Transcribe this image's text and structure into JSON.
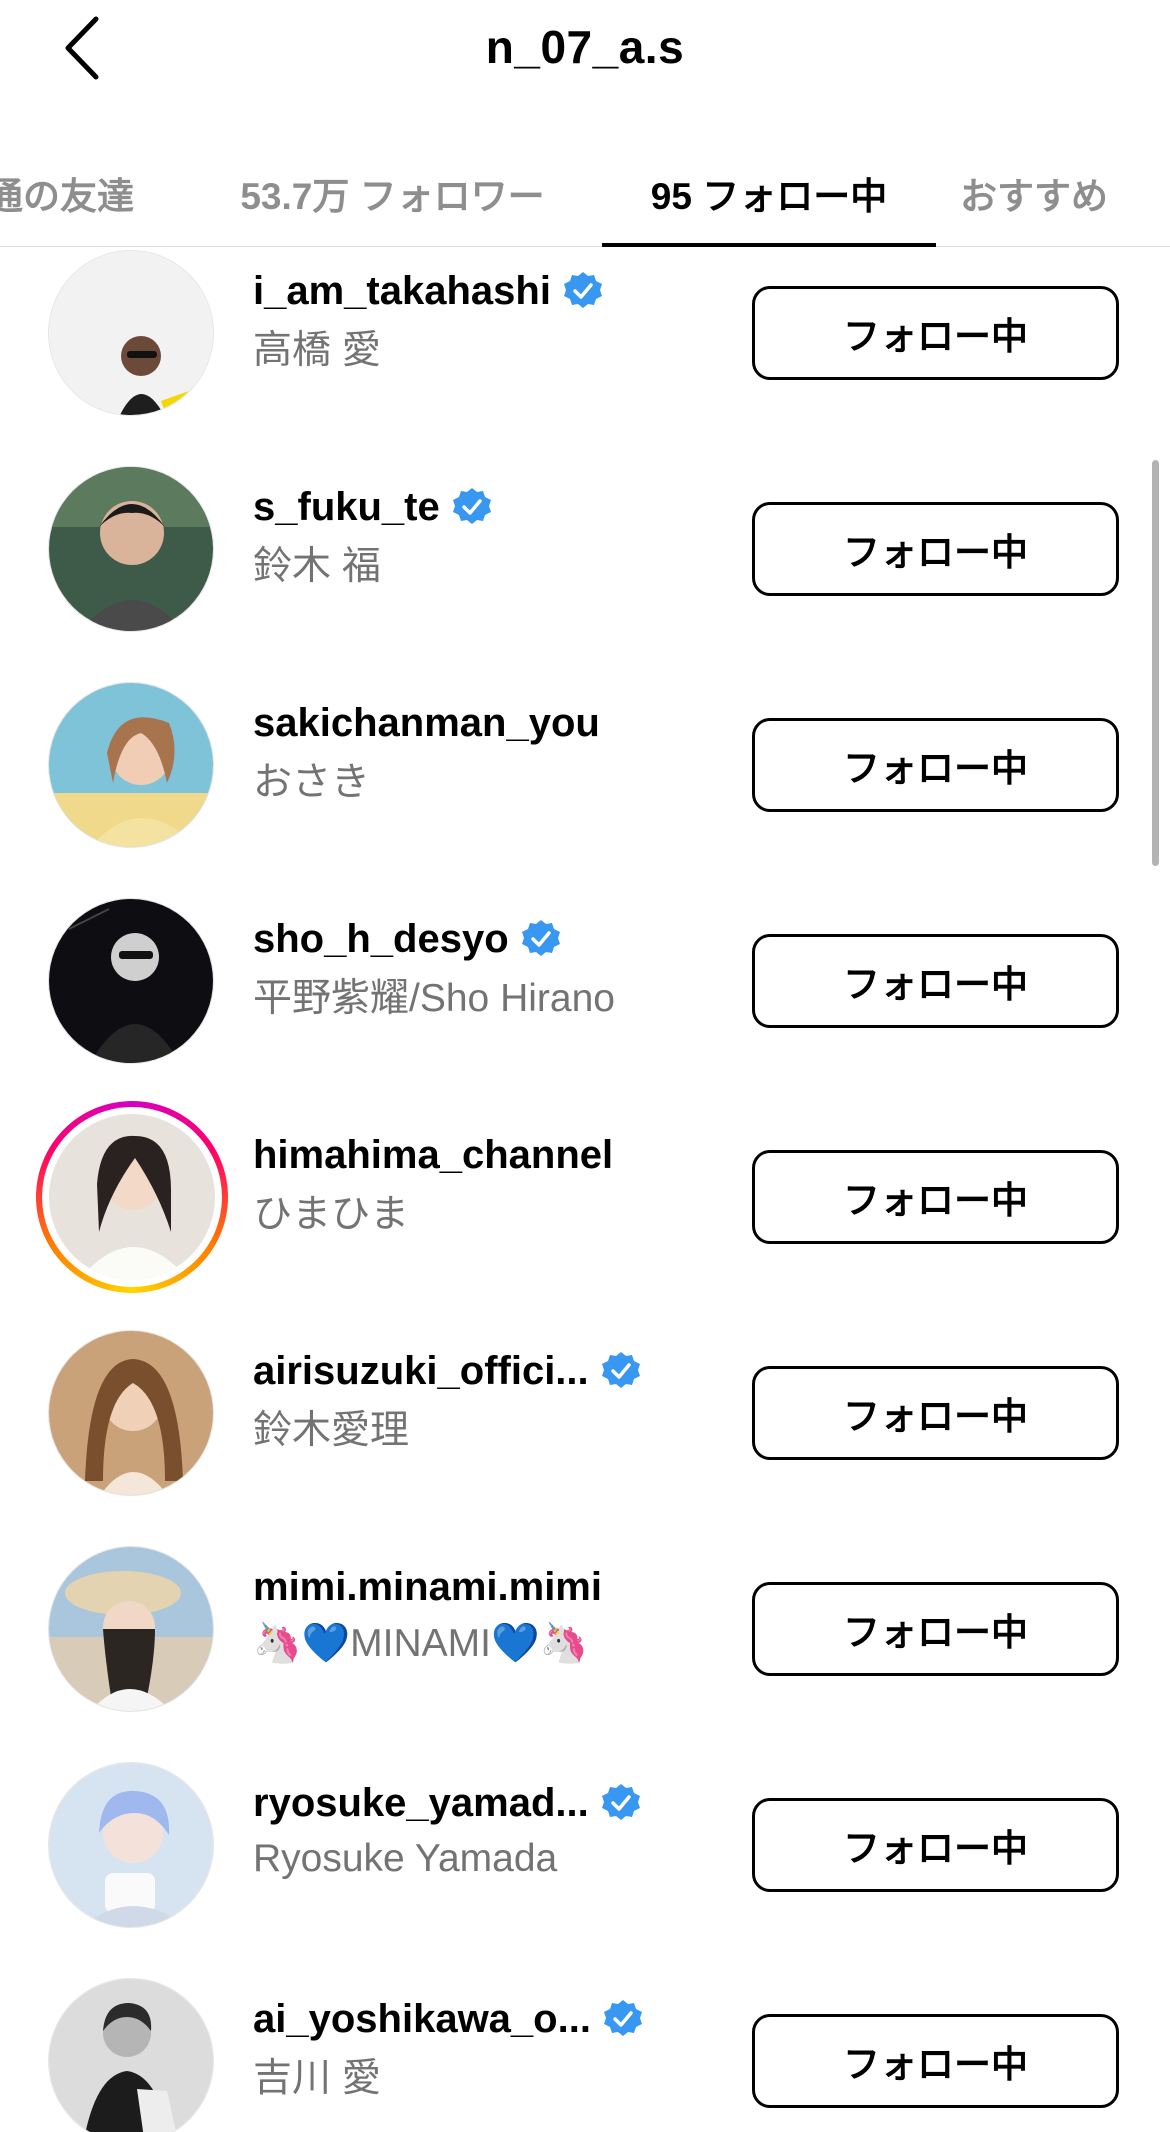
{
  "header": {
    "title": "n_07_a.s"
  },
  "tabs": [
    {
      "label": "通の友達",
      "active": false
    },
    {
      "label": "53.7万 フォロワー",
      "active": false
    },
    {
      "label": "95 フォロー中",
      "active": true
    },
    {
      "label": "おすすめ",
      "active": false
    }
  ],
  "following": [
    {
      "username": "i_am_takahashi",
      "full_name": "高橋 愛",
      "verified": true,
      "story_ring": false,
      "button": "フォロー中"
    },
    {
      "username": "s_fuku_te",
      "full_name": "鈴木 福",
      "verified": true,
      "story_ring": false,
      "button": "フォロー中"
    },
    {
      "username": "sakichanman_you",
      "full_name": "おさき",
      "verified": false,
      "story_ring": false,
      "button": "フォロー中"
    },
    {
      "username": "sho_h_desyo",
      "full_name": "平野紫耀/Sho Hirano",
      "verified": true,
      "story_ring": false,
      "button": "フォロー中"
    },
    {
      "username": "himahima_channel",
      "full_name": "ひまひま",
      "verified": false,
      "story_ring": true,
      "button": "フォロー中"
    },
    {
      "username": "airisuzuki_offici...",
      "full_name": "鈴木愛理",
      "verified": true,
      "story_ring": false,
      "button": "フォロー中"
    },
    {
      "username": "mimi.minami.mimi",
      "full_name": "🦄💙MINAMI💙🦄",
      "verified": false,
      "story_ring": false,
      "button": "フォロー中"
    },
    {
      "username": "ryosuke_yamad...",
      "full_name": "Ryosuke Yamada",
      "verified": true,
      "story_ring": false,
      "button": "フォロー中"
    },
    {
      "username": "ai_yoshikawa_o...",
      "full_name": "吉川 愛",
      "verified": true,
      "story_ring": false,
      "button": "フォロー中"
    }
  ],
  "colors": {
    "verified": "#3897f0",
    "secondary_text": "#737373",
    "inactive_tab": "#8e8e8e",
    "story_ring_gradient": [
      "#d300c5",
      "#ff0069",
      "#ff7a00",
      "#ffd600"
    ]
  },
  "icons": {
    "back": "chevron-left-icon",
    "verified": "verified-badge-icon"
  }
}
